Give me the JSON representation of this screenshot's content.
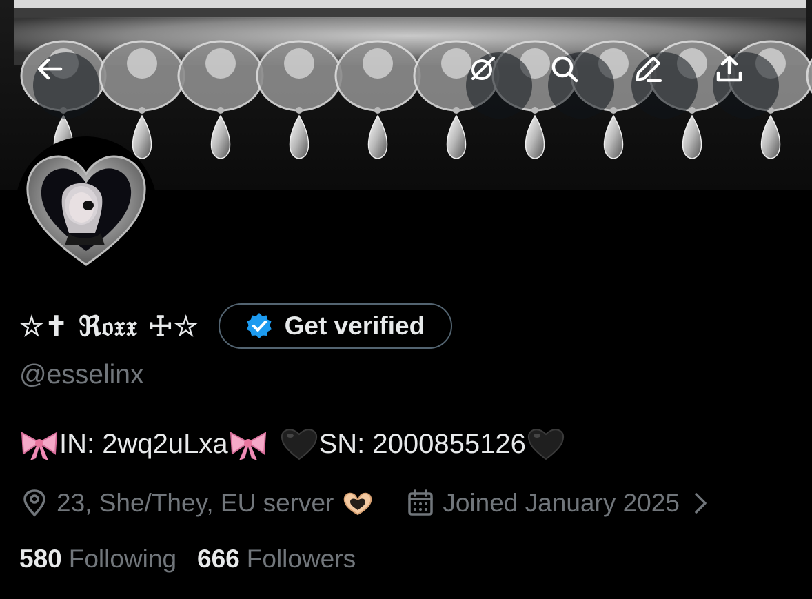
{
  "profile": {
    "display_name": "☆✝ ℜ𝔬𝔵𝔵 ☩☆",
    "handle": "@esselinx",
    "get_verified_label": "Get verified",
    "bio_in": "IN: 2wq2uLxa",
    "bio_sn": "SN: 2000855126",
    "location": "23, She/They, EU server",
    "joined": "Joined January 2025",
    "following_count": "580",
    "following_label": "Following",
    "followers_count": "666",
    "followers_label": "Followers"
  },
  "icons": {
    "back": "arrow-left-icon",
    "grok": "grok-icon",
    "search": "search-icon",
    "edit": "edit-icon",
    "share": "share-icon",
    "verified": "verified-badge-icon",
    "location": "location-pin-icon",
    "calendar": "calendar-icon",
    "chevron": "chevron-right-icon"
  },
  "colors": {
    "background": "#000000",
    "text_primary": "#e7e9ea",
    "text_secondary": "#71767b",
    "verified_blue": "#1d9bf0",
    "border": "#536471",
    "bow_pink": "#f5a9c8",
    "heart_black": "#1f1f1f"
  }
}
